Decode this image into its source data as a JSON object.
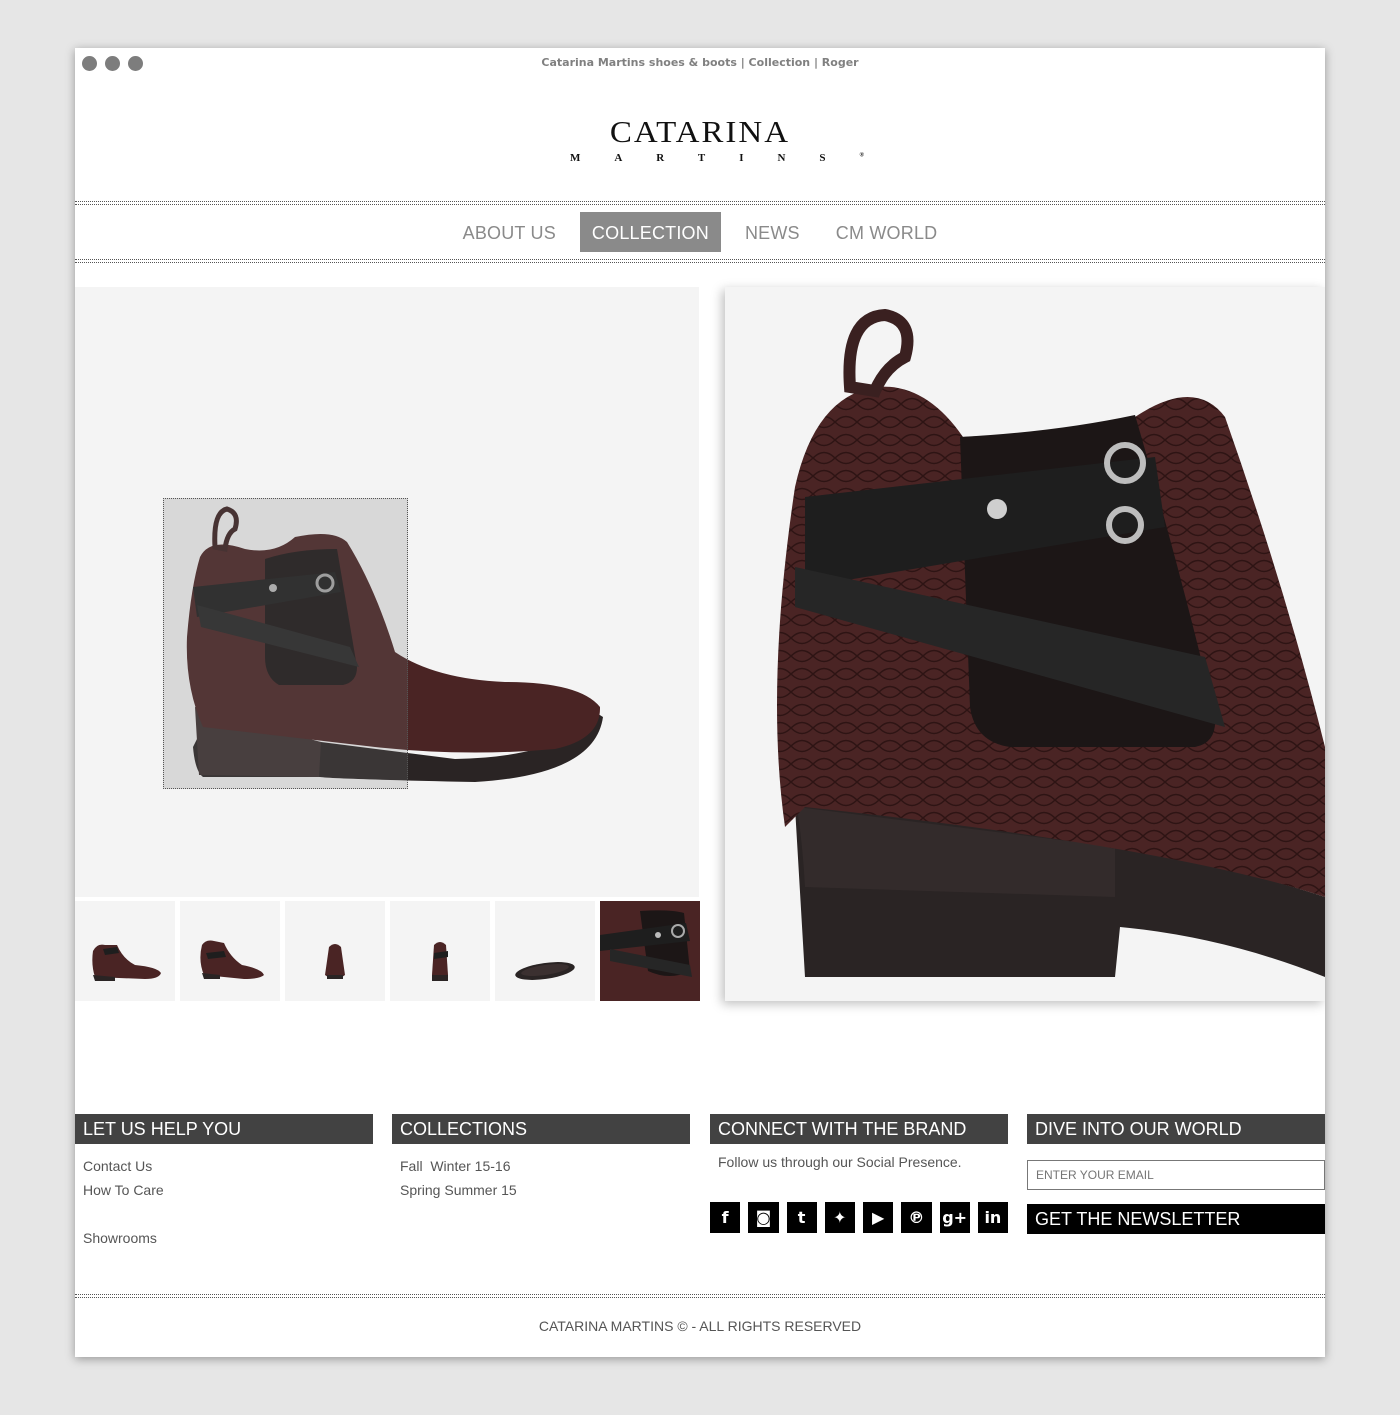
{
  "window": {
    "title": "Catarina Martins shoes & boots | Collection | Roger"
  },
  "logo": {
    "main": "CATARINA",
    "sub": "MARTINS",
    "mark": "®"
  },
  "nav": [
    {
      "label": "ABOUT US",
      "active": false
    },
    {
      "label": "COLLECTION",
      "active": true
    },
    {
      "label": "NEWS",
      "active": false
    },
    {
      "label": "CM WORLD",
      "active": false
    }
  ],
  "gallery": {
    "thumbnails": [
      "boot-side-view",
      "boot-angle-view",
      "boot-front-view",
      "boot-back-view",
      "boot-sole-view",
      "boot-detail-view"
    ],
    "colors": {
      "leather": "#4a2424",
      "strap": "#1e1e1e",
      "sole": "#2a2424",
      "background": "#f4f4f4"
    }
  },
  "footer": {
    "help": {
      "title": "LET US HELP YOU",
      "links": [
        "Contact Us",
        "How To Care",
        "Showrooms"
      ]
    },
    "collections": {
      "title": "COLLECTIONS",
      "links": [
        "Fall  Winter 15-16",
        "Spring Summer 15"
      ]
    },
    "connect": {
      "title": "CONNECT WITH THE BRAND",
      "text": "Follow us through our Social Presence.",
      "socials": [
        {
          "name": "facebook-icon",
          "glyph": "f"
        },
        {
          "name": "instagram-icon",
          "glyph": "◙"
        },
        {
          "name": "tumblr-icon",
          "glyph": "t"
        },
        {
          "name": "twitter-icon",
          "glyph": "✦"
        },
        {
          "name": "youtube-icon",
          "glyph": "▶"
        },
        {
          "name": "pinterest-icon",
          "glyph": "℗"
        },
        {
          "name": "googleplus-icon",
          "glyph": "g+"
        },
        {
          "name": "linkedin-icon",
          "glyph": "in"
        }
      ]
    },
    "world": {
      "title": "DIVE INTO OUR WORLD",
      "email_placeholder": "ENTER YOUR EMAIL",
      "button": "GET THE NEWSLETTER"
    }
  },
  "copyright": "CATARINA MARTINS © - ALL RIGHTS RESERVED"
}
